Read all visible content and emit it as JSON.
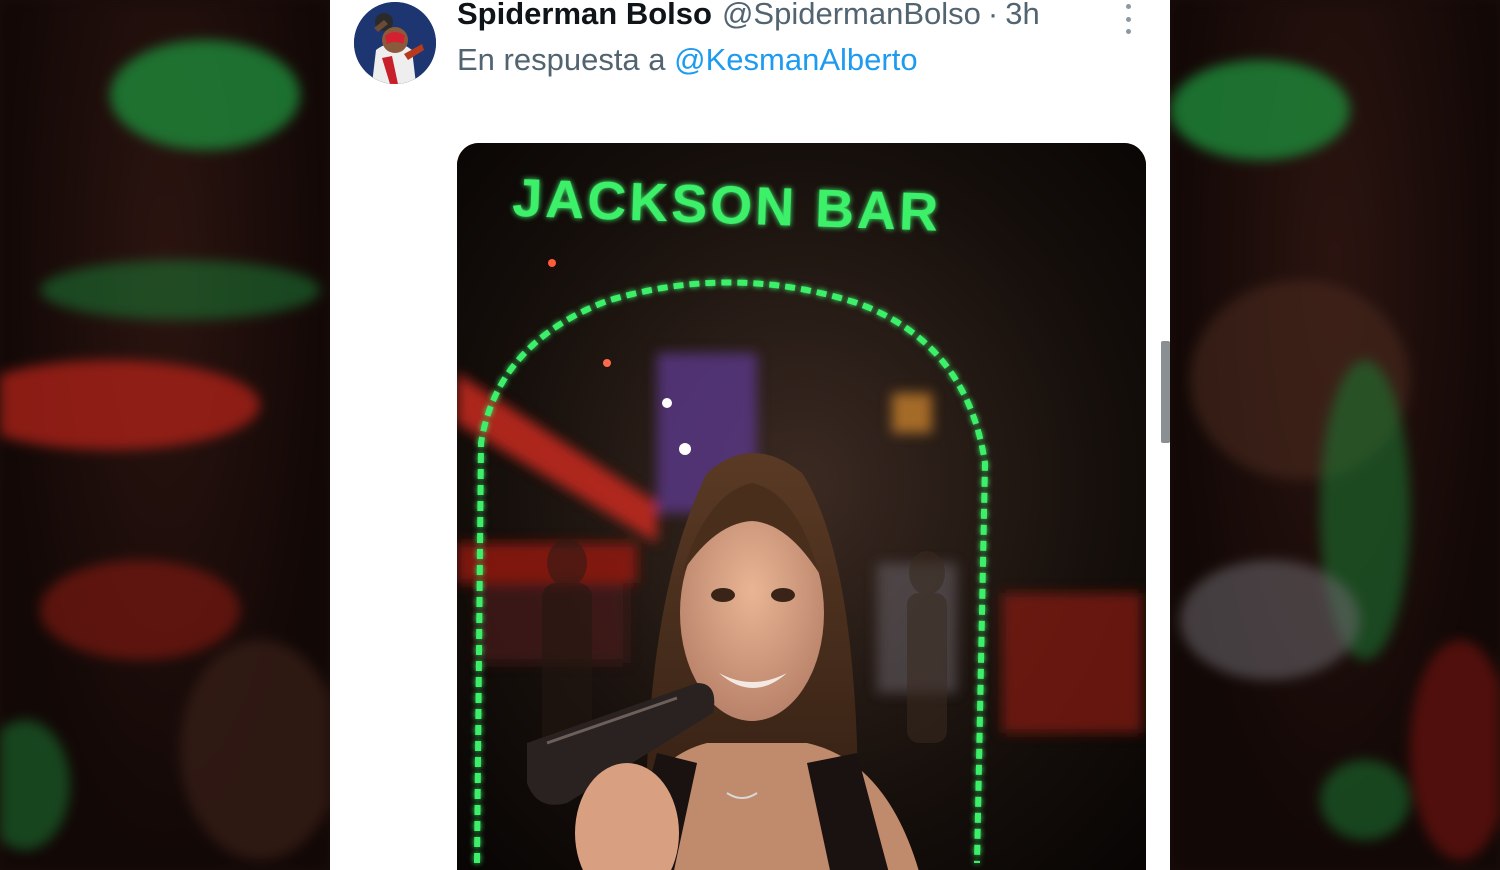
{
  "tweet": {
    "display_name": "Spiderman Bolso",
    "handle": "@SpidermanBolso",
    "separator": "·",
    "time": "3h",
    "reply_prefix": "En respuesta a",
    "reply_to": "@KesmanAlberto",
    "more_icon": "more-vertical-icon"
  },
  "media": {
    "sign_text": "JACKSON BAR",
    "neon_color": "#3ef06a"
  },
  "colors": {
    "text_primary": "#0f1419",
    "text_secondary": "#536471",
    "link": "#1d9bf0"
  }
}
